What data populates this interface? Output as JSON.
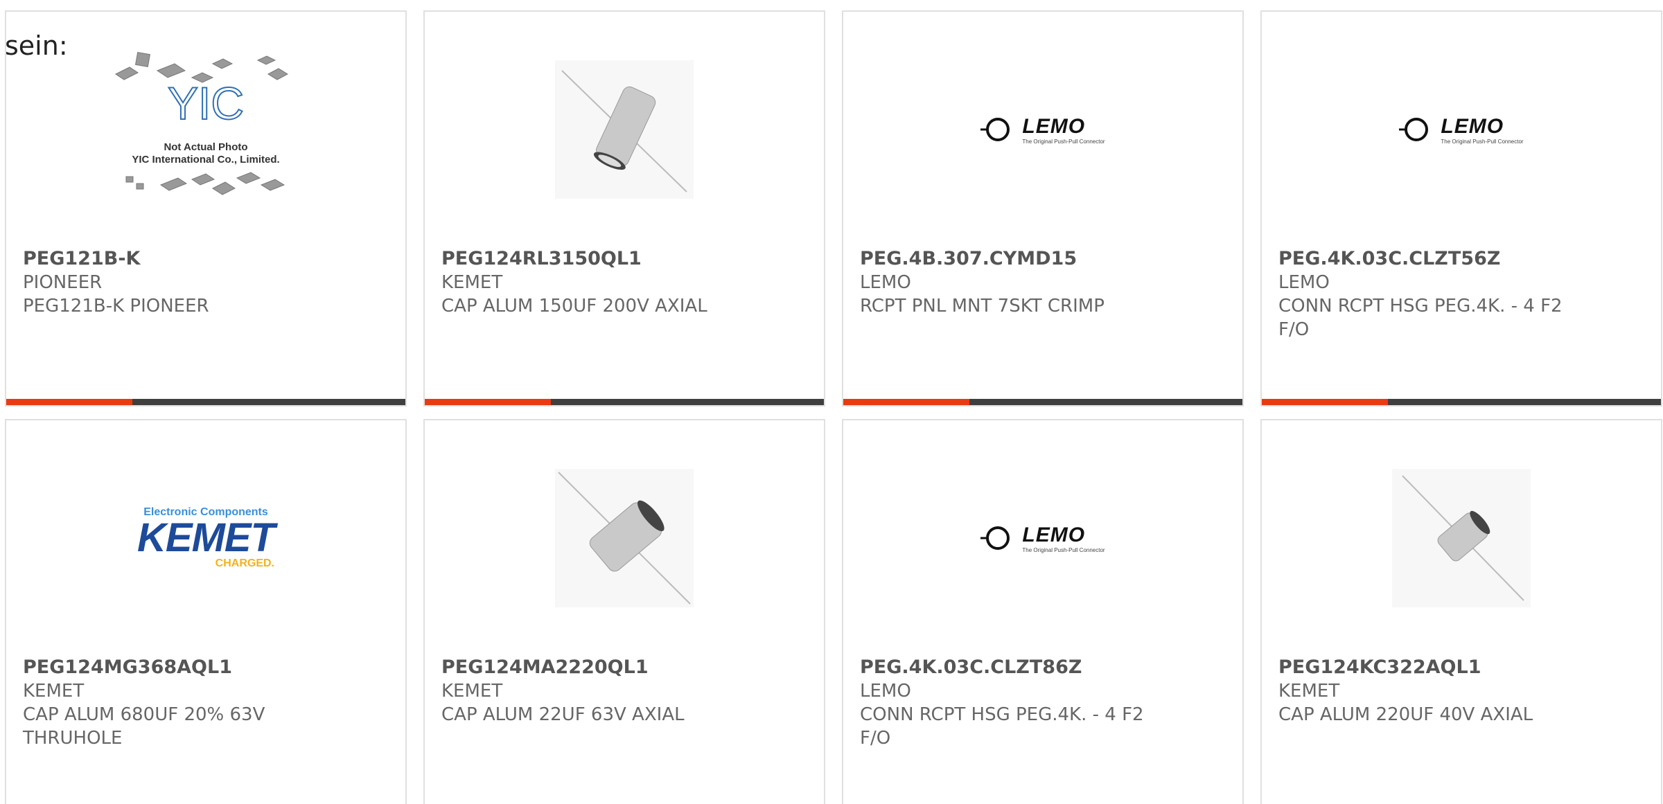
{
  "heading": "sein:",
  "colors": {
    "accent": "#ea3a12",
    "bar": "#3f3f3f",
    "text": "#666666",
    "card_border": "#e0e0e0"
  },
  "products": [
    {
      "part_number": "PEG121B-K",
      "manufacturer": "PIONEER",
      "description": "PEG121B-K PIONEER",
      "image": "yic-not-actual-photo",
      "image_text": [
        "Not Actual Photo",
        "YIC International Co., Limited."
      ],
      "logo_text": "YIC"
    },
    {
      "part_number": "PEG124RL3150QL1",
      "manufacturer": "KEMET",
      "description": "CAP ALUM 150UF 200V AXIAL",
      "image": "axial-capacitor"
    },
    {
      "part_number": "PEG.4B.307.CYMD15",
      "manufacturer": "LEMO",
      "description": "RCPT PNL MNT 7SKT CRIMP",
      "image": "lemo-logo",
      "logo_text": "LEMO",
      "logo_tagline": "The Original Push-Pull Connector"
    },
    {
      "part_number": "PEG.4K.03C.CLZT56Z",
      "manufacturer": "LEMO",
      "description": "CONN RCPT HSG PEG.4K. - 4 F2 F/O",
      "image": "lemo-logo",
      "logo_text": "LEMO",
      "logo_tagline": "The Original Push-Pull Connector"
    },
    {
      "part_number": "PEG124MG368AQL1",
      "manufacturer": "KEMET",
      "description": "CAP ALUM 680UF 20% 63V THRUHOLE",
      "image": "kemet-logo",
      "logo_text": "KEMET",
      "logo_top": "Electronic Components",
      "logo_bottom": "CHARGED."
    },
    {
      "part_number": "PEG124MA2220QL1",
      "manufacturer": "KEMET",
      "description": "CAP ALUM 22UF 63V AXIAL",
      "image": "axial-capacitor"
    },
    {
      "part_number": "PEG.4K.03C.CLZT86Z",
      "manufacturer": "LEMO",
      "description": "CONN RCPT HSG PEG.4K. - 4 F2 F/O",
      "image": "lemo-logo",
      "logo_text": "LEMO",
      "logo_tagline": "The Original Push-Pull Connector"
    },
    {
      "part_number": "PEG124KC322AQL1",
      "manufacturer": "KEMET",
      "description": "CAP ALUM 220UF 40V AXIAL",
      "image": "axial-capacitor-small"
    }
  ]
}
